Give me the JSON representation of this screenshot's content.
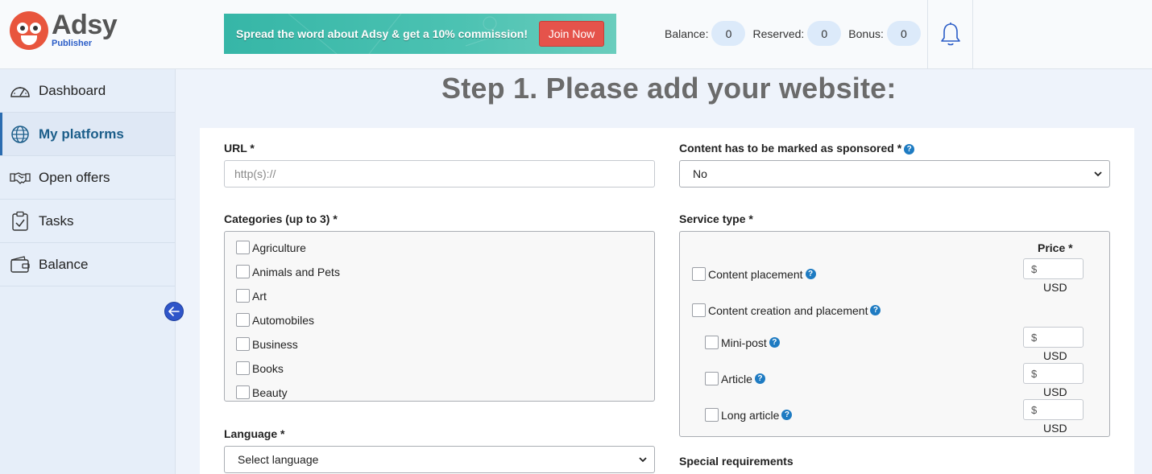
{
  "brand": {
    "name": "Adsy",
    "sub": "Publisher"
  },
  "banner": {
    "text": "Spread the word about Adsy & get a 10% commission!",
    "button": "Join Now"
  },
  "stats": [
    {
      "label": "Balance:",
      "value": "0"
    },
    {
      "label": "Reserved:",
      "value": "0"
    },
    {
      "label": "Bonus:",
      "value": "0"
    }
  ],
  "sidebar": {
    "items": [
      {
        "label": "Dashboard",
        "icon": "gauge-icon"
      },
      {
        "label": "My platforms",
        "icon": "globe-icon",
        "active": true
      },
      {
        "label": "Open offers",
        "icon": "handshake-icon"
      },
      {
        "label": "Tasks",
        "icon": "clipboard-check-icon"
      },
      {
        "label": "Balance",
        "icon": "wallet-icon"
      }
    ]
  },
  "page": {
    "title": "Step 1. Please add your website:"
  },
  "form": {
    "url_label": "URL *",
    "url_placeholder": "http(s)://",
    "sponsored_label": "Content has to be marked as sponsored *",
    "sponsored_value": "No",
    "categories_label": "Categories (up to 3) *",
    "categories": [
      "Agriculture",
      "Animals and Pets",
      "Art",
      "Automobiles",
      "Business",
      "Books",
      "Beauty"
    ],
    "language_label": "Language *",
    "language_value": "Select language",
    "service_label": "Service type *",
    "price_header": "Price *",
    "currency_symbol": "$",
    "currency": "USD",
    "services": {
      "content_placement": "Content placement",
      "creation_and_placement": "Content creation and placement",
      "mini_post": "Mini-post",
      "article": "Article",
      "long_article": "Long article"
    },
    "special_label": "Special requirements"
  },
  "colors": {
    "accent": "#2f55c9",
    "help": "#1e7bc2",
    "join": "#e5534b",
    "banner": "#36b6a7"
  }
}
